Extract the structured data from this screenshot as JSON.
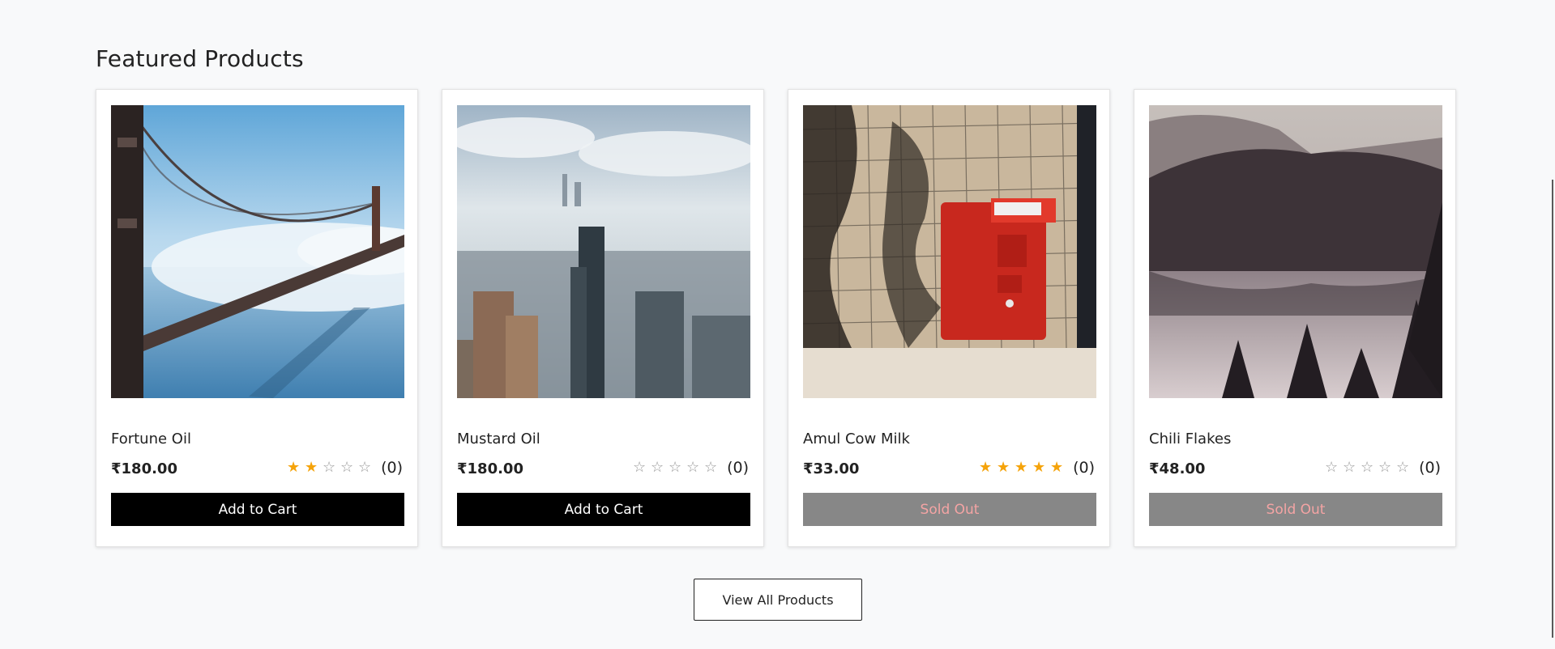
{
  "section": {
    "title": "Featured Products"
  },
  "products": [
    {
      "name": "Fortune Oil",
      "price": "₹180.00",
      "rating": 2,
      "review_count": "(0)",
      "button_label": "Add to Cart",
      "sold_out": false
    },
    {
      "name": "Mustard Oil",
      "price": "₹180.00",
      "rating": 0,
      "review_count": "(0)",
      "button_label": "Add to Cart",
      "sold_out": false
    },
    {
      "name": "Amul Cow Milk",
      "price": "₹33.00",
      "rating": 5,
      "review_count": "(0)",
      "button_label": "Sold Out",
      "sold_out": true
    },
    {
      "name": "Chili Flakes",
      "price": "₹48.00",
      "rating": 0,
      "review_count": "(0)",
      "button_label": "Sold Out",
      "sold_out": true
    }
  ],
  "view_all_label": "View All Products",
  "colors": {
    "star_filled": "#f5a30a",
    "button_primary": "#000000",
    "button_disabled": "#878787",
    "sold_out_text": "#f4a4a4"
  }
}
